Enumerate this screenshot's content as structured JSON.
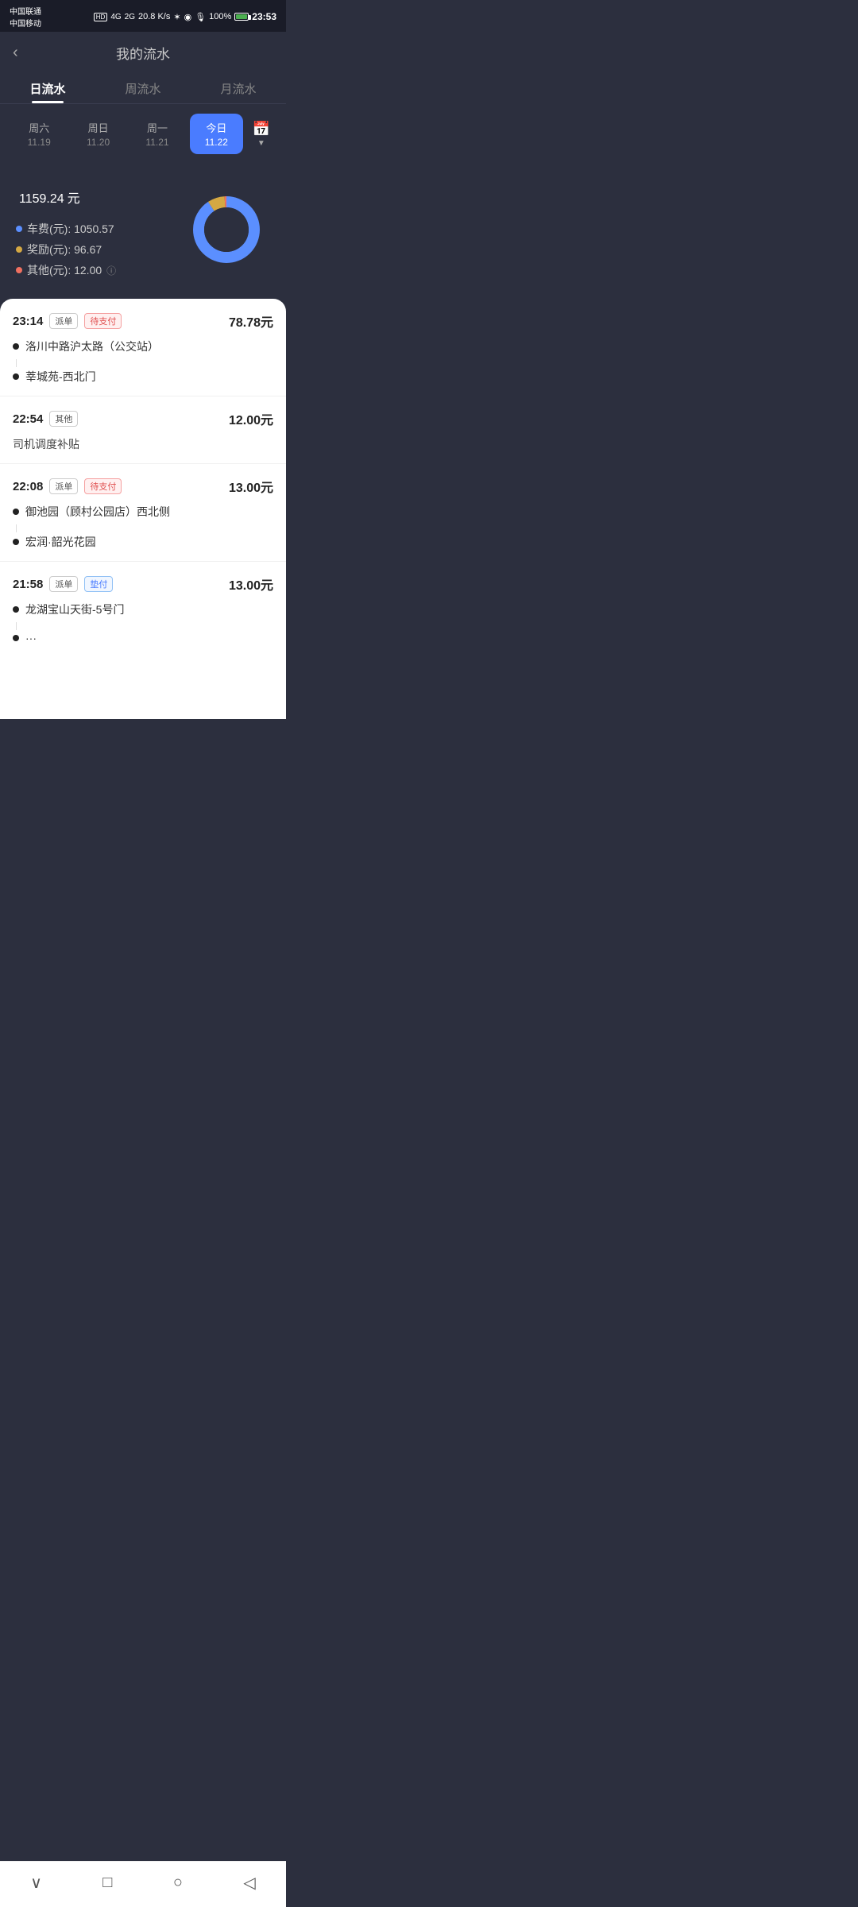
{
  "statusBar": {
    "carrier1": "中国联通",
    "carrier2": "中国移动",
    "hd": "HD",
    "signal1": "4G",
    "signal2": "2G",
    "speed": "20.8 K/s",
    "battery": "100%",
    "time": "23:53"
  },
  "header": {
    "backLabel": "‹",
    "title": "我的流水"
  },
  "tabs": [
    {
      "label": "日流水",
      "active": true
    },
    {
      "label": "周流水",
      "active": false
    },
    {
      "label": "月流水",
      "active": false
    }
  ],
  "dateRow": [
    {
      "day": "周六",
      "date": "11.19",
      "active": false
    },
    {
      "day": "周日",
      "date": "11.20",
      "active": false
    },
    {
      "day": "周一",
      "date": "11.21",
      "active": false
    },
    {
      "day": "今日",
      "date": "11.22",
      "active": true
    }
  ],
  "summary": {
    "amount": "1159.24",
    "unit": "元",
    "legends": [
      {
        "color": "#5b8fff",
        "label": "车费(元): 1050.57"
      },
      {
        "color": "#d4a843",
        "label": "奖励(元): 96.67"
      },
      {
        "color": "#f07060",
        "label": "其他(元): 12.00"
      }
    ],
    "chart": {
      "segments": [
        {
          "percent": 90.6,
          "color": "#5b8fff"
        },
        {
          "percent": 8.3,
          "color": "#d4a843"
        },
        {
          "percent": 1.1,
          "color": "#f07060"
        }
      ]
    }
  },
  "transactions": [
    {
      "time": "23:14",
      "tag": "派单",
      "tagType": "default",
      "statusTag": "待支付",
      "statusTagType": "red",
      "amount": "78.78元",
      "routePoints": [
        {
          "label": "洛川中路沪太路（公交站）"
        },
        {
          "label": "莘城苑-西北门"
        }
      ],
      "desc": null
    },
    {
      "time": "22:54",
      "tag": "其他",
      "tagType": "default",
      "statusTag": null,
      "amount": "12.00元",
      "routePoints": [],
      "desc": "司机调度补贴"
    },
    {
      "time": "22:08",
      "tag": "派单",
      "tagType": "default",
      "statusTag": "待支付",
      "statusTagType": "red",
      "amount": "13.00元",
      "routePoints": [
        {
          "label": "御池园（顾村公园店）西北侧"
        },
        {
          "label": "宏润·韶光花园"
        }
      ],
      "desc": null
    },
    {
      "time": "21:58",
      "tag": "派单",
      "tagType": "default",
      "statusTag": "垫付",
      "statusTagType": "blue",
      "amount": "13.00元",
      "routePoints": [
        {
          "label": "龙湖宝山天街-5号门"
        },
        {
          "label": "···"
        }
      ],
      "desc": null
    }
  ],
  "bottomNav": {
    "chevronDown": "∨",
    "square": "□",
    "circle": "○",
    "triangle": "◁"
  }
}
